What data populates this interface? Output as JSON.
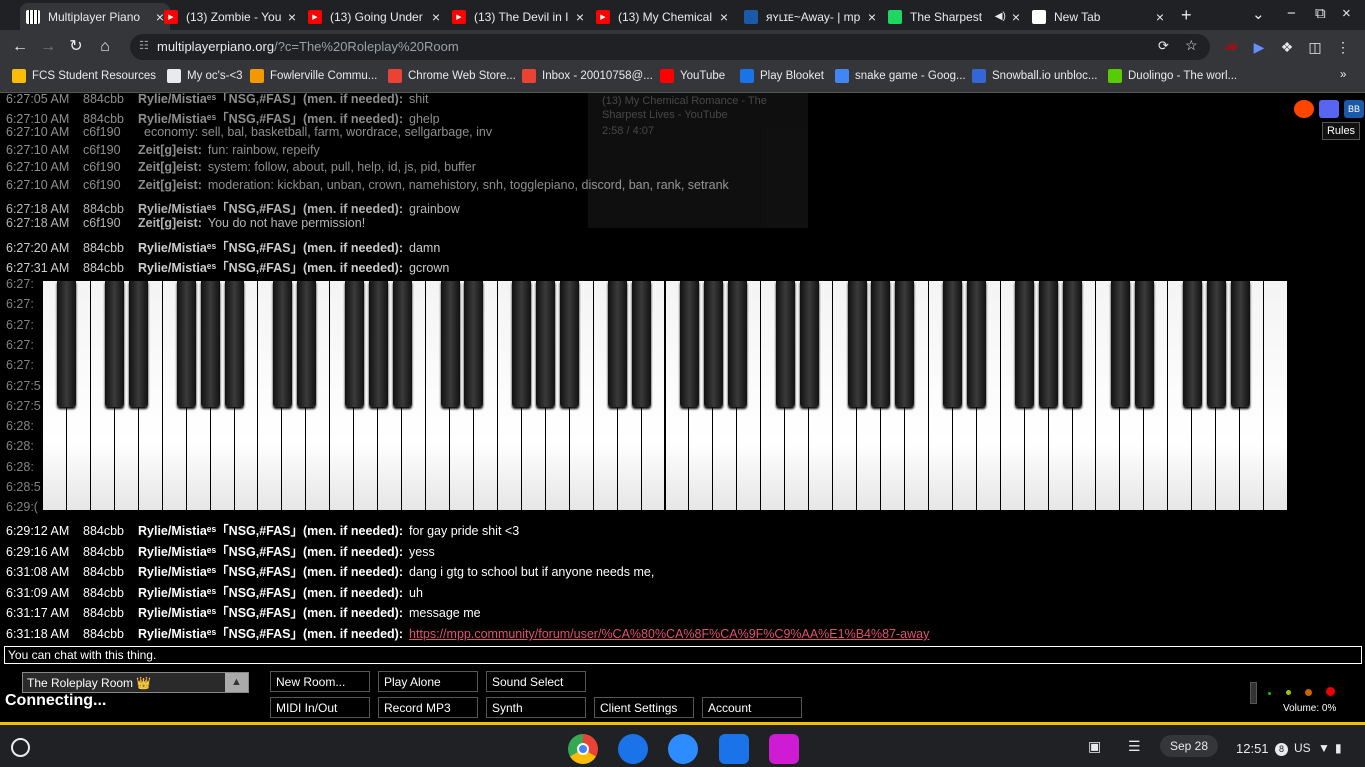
{
  "tabs": [
    {
      "title": "Multiplayer Piano",
      "icon": "piano-icon",
      "active": true
    },
    {
      "title": "(13) Zombie - You",
      "icon": "youtube-icon"
    },
    {
      "title": "(13) Going Under",
      "icon": "youtube-icon"
    },
    {
      "title": "(13) The Devil in I",
      "icon": "youtube-icon"
    },
    {
      "title": "(13) My Chemical I",
      "icon": "youtube-icon"
    },
    {
      "title": "ᴙʏʟɪᴇ~Away- | mp",
      "icon": "mpp-icon"
    },
    {
      "title": "The Sharpest",
      "icon": "spotify-icon"
    },
    {
      "title": "New Tab",
      "icon": "chrome-icon"
    }
  ],
  "url": {
    "host": "multiplayerpiano.org",
    "path": "/?c=The%20Roleplay%20Room"
  },
  "bookmarks": [
    "FCS Student Resources",
    "My oc's-<3",
    "Fowlerville Commu...",
    "Chrome Web Store...",
    "Inbox - 20010758@...",
    "YouTube",
    "Play Blooket",
    "snake game - Goog...",
    "Snowball.io unbloc...",
    "Duolingo - The worl..."
  ],
  "chat_top": [
    {
      "time": "6:27:05 AM",
      "id": "884cbb",
      "name": "Rylie/Mistiaᵉˢ「NSG,#FAS」(men. if needed):",
      "text": "shit"
    },
    {
      "time": "6:27:10 AM",
      "id": "884cbb",
      "name": "Rylie/Mistiaᵉˢ「NSG,#FAS」(men. if needed):",
      "text": "ghelp"
    },
    {
      "time": "6:27:10 AM",
      "id": "c6f190",
      "name": "",
      "text": "economy: sell, bal, basketball, farm, wordrace, sellgarbage, inv"
    },
    {
      "time": "6:27:10 AM",
      "id": "c6f190",
      "name": "Zeit[g]eist:",
      "text": "fun: rainbow, repeify"
    },
    {
      "time": "6:27:10 AM",
      "id": "c6f190",
      "name": "Zeit[g]eist:",
      "text": "system: follow, about, pull, help, id, js, pid, buffer"
    },
    {
      "time": "6:27:10 AM",
      "id": "c6f190",
      "name": "Zeit[g]eist:",
      "text": "moderation: kickban, unban, crown, namehistory, snh, togglepiano, discord, ban, rank, setrank"
    },
    {
      "time": "6:27:18 AM",
      "id": "884cbb",
      "name": "Rylie/Mistiaᵉˢ「NSG,#FAS」(men. if needed):",
      "text": "grainbow"
    },
    {
      "time": "6:27:18 AM",
      "id": "c6f190",
      "name": "Zeit[g]eist:",
      "text": "You do not have permission!"
    },
    {
      "time": "6:27:20 AM",
      "id": "884cbb",
      "name": "Rylie/Mistiaᵉˢ「NSG,#FAS」(men. if needed):",
      "text": "damn"
    },
    {
      "time": "6:27:31 AM",
      "id": "884cbb",
      "name": "Rylie/Mistiaᵉˢ「NSG,#FAS」(men. if needed):",
      "text": "gcrown"
    }
  ],
  "chat_hidden_times": [
    "6:27:",
    "6:27:",
    "6:27:",
    "6:27:",
    "6:27:",
    "6:27:5",
    "6:27:5",
    "6:28:",
    "6:28:",
    "6:28:",
    "6:28:5",
    "6:29:("
  ],
  "chat_bottom": [
    {
      "time": "6:29:12 AM",
      "id": "884cbb",
      "name": "Rylie/Mistiaᵉˢ「NSG,#FAS」(men. if needed):",
      "text": "for gay pride shit <3"
    },
    {
      "time": "6:29:16 AM",
      "id": "884cbb",
      "name": "Rylie/Mistiaᵉˢ「NSG,#FAS」(men. if needed):",
      "text": "yess"
    },
    {
      "time": "6:31:08 AM",
      "id": "884cbb",
      "name": "Rylie/Mistiaᵉˢ「NSG,#FAS」(men. if needed):",
      "text": "dang i gtg to school but if anyone needs me,"
    },
    {
      "time": "6:31:09 AM",
      "id": "884cbb",
      "name": "Rylie/Mistiaᵉˢ「NSG,#FAS」(men. if needed):",
      "text": "uh"
    },
    {
      "time": "6:31:17 AM",
      "id": "884cbb",
      "name": "Rylie/Mistiaᵉˢ「NSG,#FAS」(men. if needed):",
      "text": "message me"
    },
    {
      "time": "6:31:18 AM",
      "id": "884cbb",
      "name": "Rylie/Mistiaᵉˢ「NSG,#FAS」(men. if needed):",
      "link": "https://mpp.community/forum/user/%CA%80%CA%8F%CA%9F%C9%AA%E1%B4%87-away"
    }
  ],
  "ghost_popup": [
    "(13) My Chemical Romance - The",
    "Sharpest Lives - YouTube",
    "2:58 / 4:07"
  ],
  "chat_input_placeholder": "You can chat with this thing.",
  "room": {
    "name": "The Roleplay Room 👑",
    "status": "Connecting..."
  },
  "buttons": [
    "New Room...",
    "Play Alone",
    "Sound Select",
    "MIDI In/Out",
    "Record MP3",
    "Synth",
    "Client Settings",
    "Account"
  ],
  "rules_label": "Rules",
  "volume_label": "Volume: 0%",
  "volume_level": 0,
  "shelf": {
    "date": "Sep 28",
    "time": "12:51",
    "locale": "US",
    "notif_count": "8"
  },
  "colors": {
    "accent": "#f0c000",
    "link": "#e05070"
  }
}
